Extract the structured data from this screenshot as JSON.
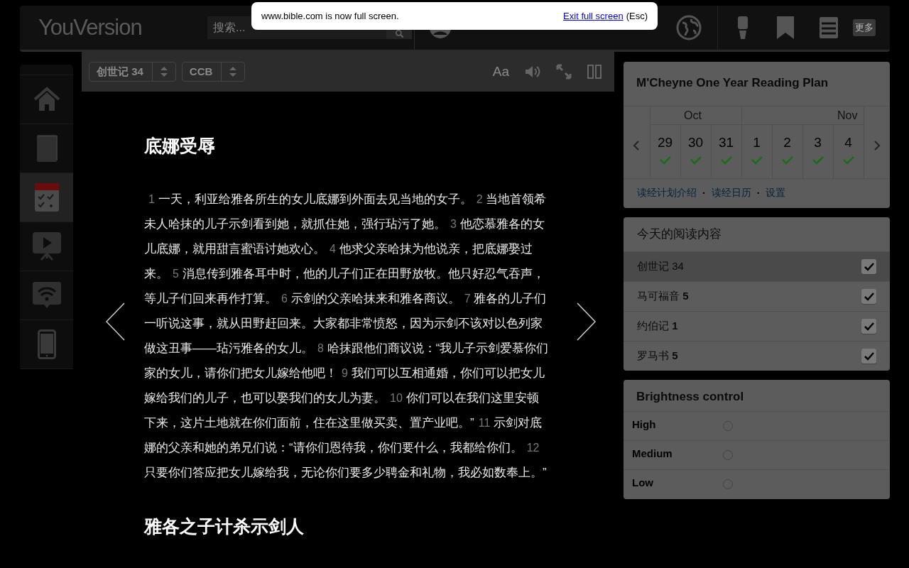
{
  "fullscreen_notice": {
    "message": "www.bible.com is now full screen.",
    "link": "Exit full screen",
    "shortcut": "(Esc)"
  },
  "header": {
    "logo": "**You**Version",
    "search": {
      "placeholder": "搜索..."
    },
    "more_button": "更多"
  },
  "sidebar": {
    "items": [
      {
        "kind": "home",
        "selected": false
      },
      {
        "kind": "bible",
        "selected": false
      },
      {
        "kind": "plans",
        "selected": true
      },
      {
        "kind": "videos",
        "selected": false
      },
      {
        "kind": "live",
        "selected": false
      },
      {
        "kind": "apps",
        "selected": false
      }
    ]
  },
  "reader_toolbar": {
    "book_select": "创世记 34",
    "version_select": "CCB",
    "font_button": "Aa"
  },
  "reader": {
    "sections": [
      {
        "heading": "底娜受辱",
        "verses": [
          {
            "number": "1",
            "text": "一天，利亚给雅各所生的女儿底娜到外面去见当地的女子。"
          },
          {
            "number": "2",
            "text": "当地首领希未人哈抹的儿子示剑看到她，就抓住她，强行玷污了她。"
          },
          {
            "number": "3",
            "text": "他恋慕雅各的女儿底娜，就用甜言蜜语讨她欢心。"
          },
          {
            "number": "4",
            "text": "他求父亲哈抹为他说亲，把底娜娶过来。"
          },
          {
            "number": "5",
            "text": "消息传到雅各耳中时，他的儿子们正在田野放牧。他只好忍气吞声，等儿子们回来再作打算。"
          },
          {
            "number": "6",
            "text": "示剑的父亲哈抹来和雅各商议。"
          },
          {
            "number": "7",
            "text": "雅各的儿子们一听说这事，就从田野赶回来。大家都非常愤怒，因为示剑不该对以色列家做这丑事——玷污雅各的女儿。"
          },
          {
            "number": "8",
            "text": "哈抹跟他们商议说：“我儿子示剑爱慕你们家的女儿，请你们把女儿嫁给他吧！"
          },
          {
            "number": "9",
            "text": "我们可以互相通婚，你们可以把女儿嫁给我们的儿子，也可以娶我们的女儿为妻。"
          },
          {
            "number": "10",
            "text": "你们可以在我们这里安顿下来，这片土地就在你们面前，住在这里做买卖、置产业吧。”"
          },
          {
            "number": "11",
            "text": "示剑对底娜的父亲和她的弟兄们说：“请你们恩待我，你们要什么，我都给你们。"
          },
          {
            "number": "12",
            "text": "只要你们答应把女儿嫁给我，无论你们要多少聘金和礼物，我必如数奉上。”"
          }
        ]
      },
      {
        "heading": "雅各之子计杀示剑人"
      }
    ]
  },
  "plan": {
    "title": "M'Cheyne One Year Reading Plan",
    "months": [
      {
        "label": "Oct",
        "days": [
          {
            "day": "29",
            "completed": true
          },
          {
            "day": "30",
            "completed": true
          },
          {
            "day": "31",
            "completed": true
          }
        ]
      },
      {
        "label": "Nov",
        "days": [
          {
            "day": "1",
            "completed": true
          },
          {
            "day": "2",
            "completed": true
          },
          {
            "day": "3",
            "completed": true
          },
          {
            "day": "4",
            "completed": true
          }
        ]
      }
    ],
    "links": [
      "读经计划介绍",
      "读经日历",
      "设置"
    ],
    "separators": [
      "·",
      "·"
    ]
  },
  "todays_reading": {
    "title": "今天的阅读内容",
    "items": [
      {
        "label": "创世记 34",
        "checked": true,
        "selected": true
      },
      {
        "label": "马可福音 **5**",
        "checked": true,
        "selected": false
      },
      {
        "label": "约伯记 **1**",
        "checked": true,
        "selected": false
      },
      {
        "label": "罗马书 **5**",
        "checked": true,
        "selected": false
      }
    ]
  },
  "brightness": {
    "title": "Brightness control",
    "options": [
      {
        "label": "High",
        "selected": false
      },
      {
        "label": "Medium",
        "selected": false
      },
      {
        "label": "Low",
        "selected": false
      }
    ]
  }
}
